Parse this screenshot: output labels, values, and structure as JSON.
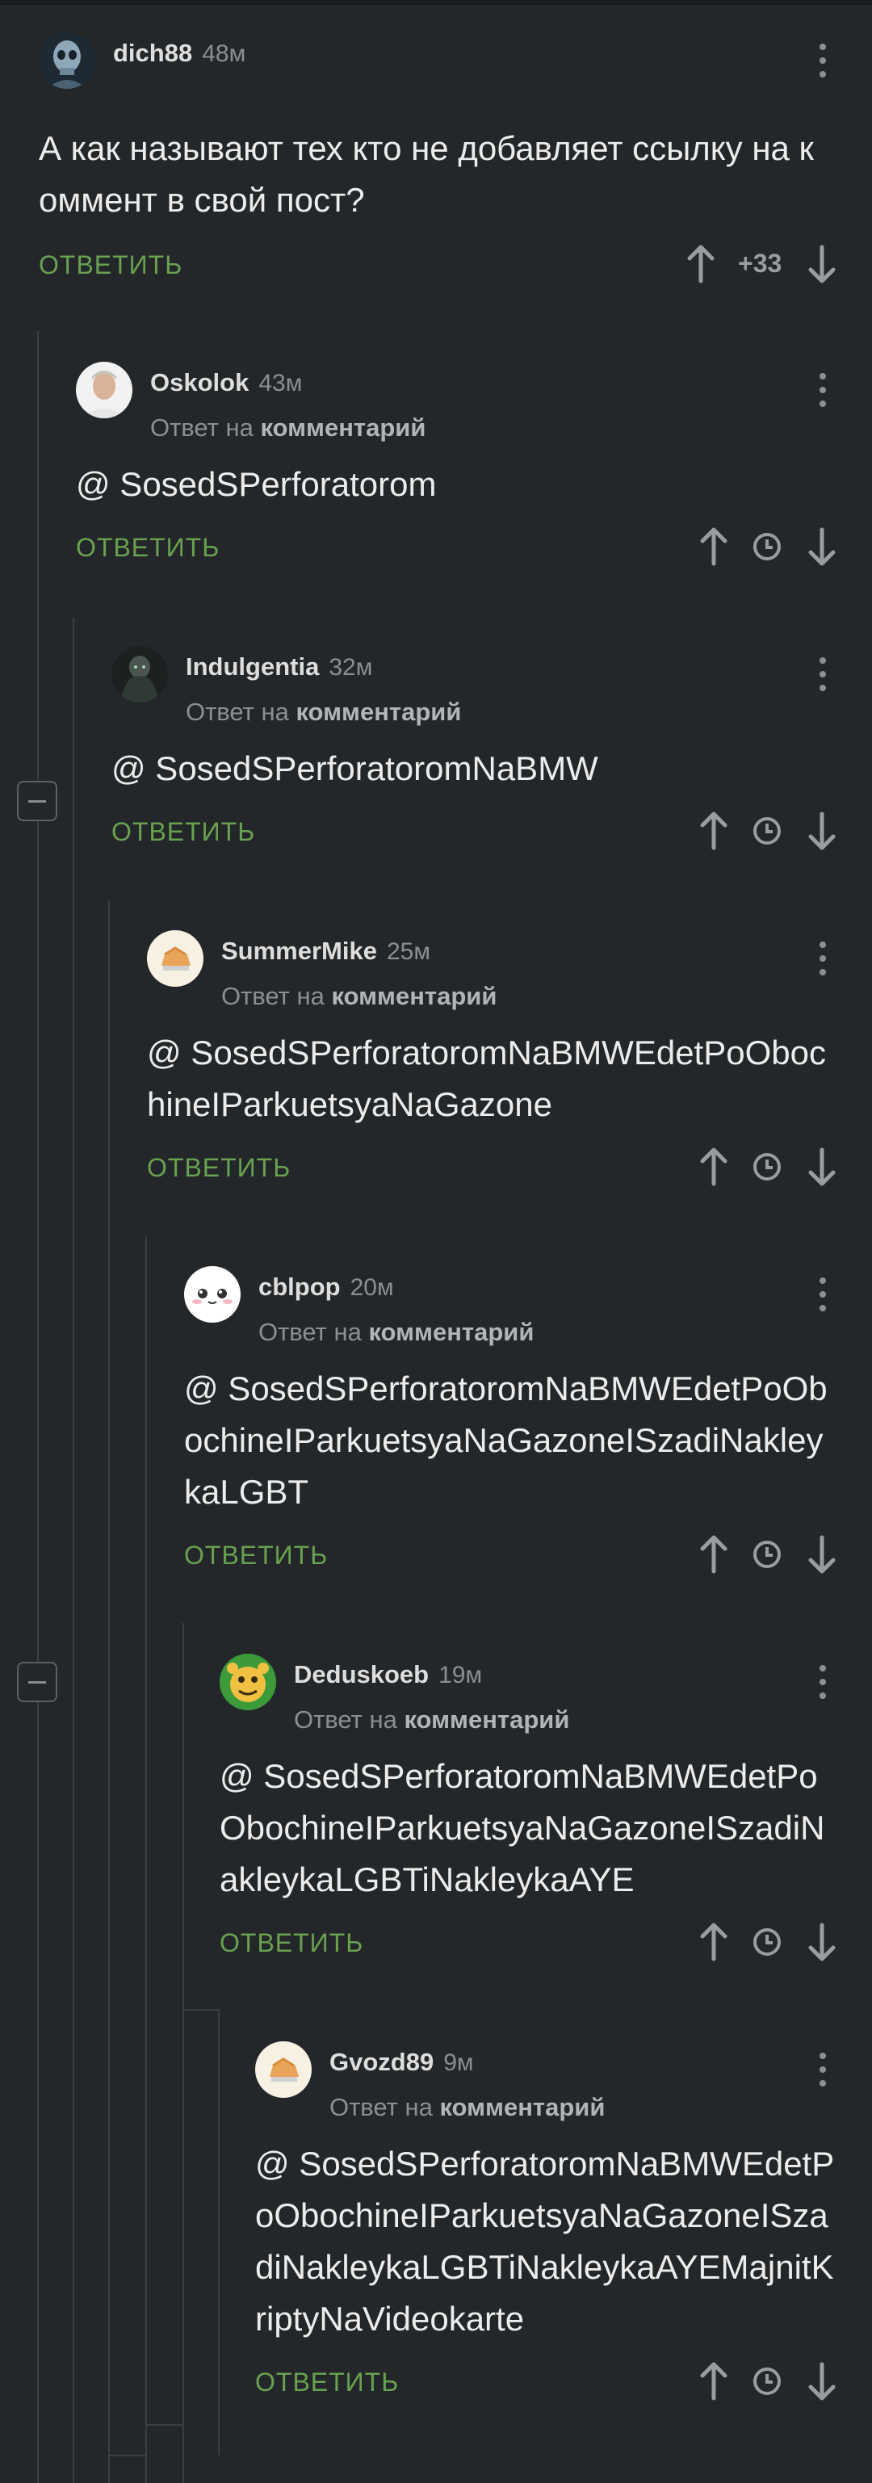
{
  "colors": {
    "background": "#242729",
    "accent_green": "#68a150",
    "muted": "#8c8f92",
    "thread_line": "#3b3f41"
  },
  "labels": {
    "reply_button": "ОТВЕТИТЬ",
    "reply_prefix": "Ответ на",
    "reply_target": "комментарий"
  },
  "comments": [
    {
      "user": "dich88",
      "time": "48м",
      "is_reply": false,
      "text": "А как называют тех кто не добавляет ссылку на коммент в свой пост?",
      "score": "+33",
      "avatar": "skull-avatar"
    },
    {
      "user": "Oskolok",
      "time": "43м",
      "is_reply": true,
      "text": "@ SosedSPerforatorom",
      "avatar": "photo-avatar"
    },
    {
      "user": "Indulgentia",
      "time": "32м",
      "is_reply": true,
      "text": "@ SosedSPerforatoromNaBMW",
      "avatar": "dark-figure-avatar"
    },
    {
      "user": "SummerMike",
      "time": "25м",
      "is_reply": true,
      "text": "@ SosedSPerforatoromNaBMWEdetPoObochineIParkuetsyaNaGazone",
      "avatar": "default-avatar"
    },
    {
      "user": "cblpop",
      "time": "20м",
      "is_reply": true,
      "text": "@ SosedSPerforatoromNaBMWEdetPoObochineIParkuetsyaNaGazoneISzadiNakleykaLGBT",
      "avatar": "cute-face-avatar"
    },
    {
      "user": "Deduskoeb",
      "time": "19м",
      "is_reply": true,
      "text": "@ SosedSPerforatoromNaBMWEdetPoObochineIParkuetsyaNaGazoneISzadiNakleykaLGBTiNakleykaAYE",
      "avatar": "cartoon-avatar"
    },
    {
      "user": "Gvozd89",
      "time": "9м",
      "is_reply": true,
      "text": "@ SosedSPerforatoromNaBMWEdetPoObochineIParkuetsyaNaGazoneISzadiNakleykaLGBTiNakleykaAYEMajnitKriptyNaVideokarte",
      "avatar": "default-avatar"
    }
  ]
}
